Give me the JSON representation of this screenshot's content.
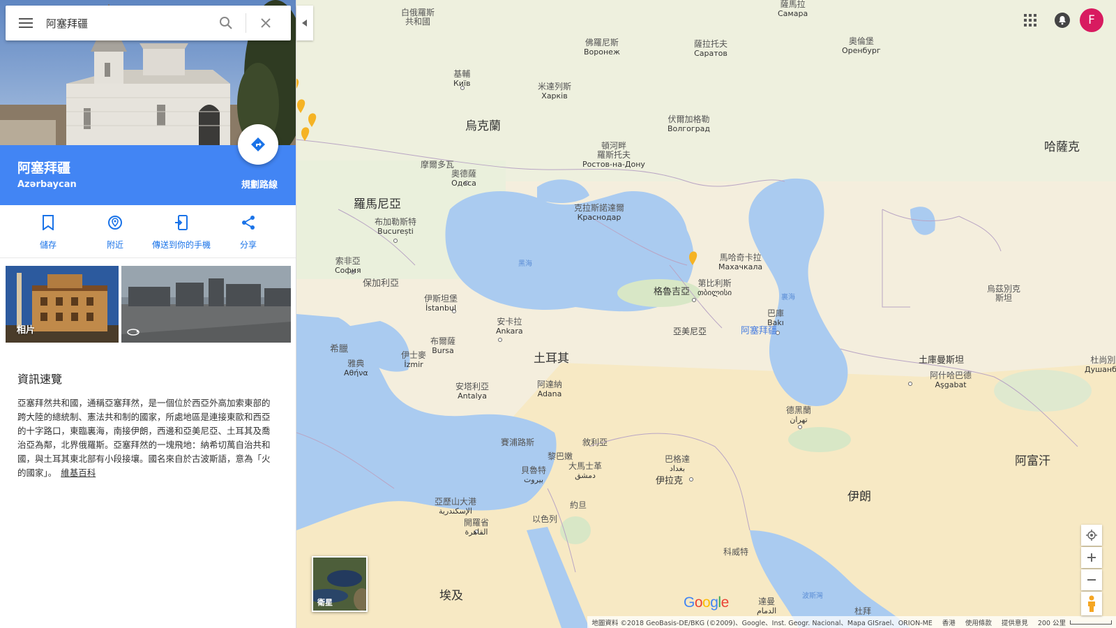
{
  "search": {
    "value": "阿塞拜疆"
  },
  "place": {
    "title": "阿塞拜疆",
    "subtitle": "Azərbaycan",
    "directions_label": "規劃路線"
  },
  "actions": [
    {
      "label": "儲存",
      "icon": "bookmark-icon"
    },
    {
      "label": "附近",
      "icon": "nearby-icon"
    },
    {
      "label": "傳送到你的手機",
      "icon": "send-to-phone-icon"
    },
    {
      "label": "分享",
      "icon": "share-icon"
    }
  ],
  "photos": {
    "label": "相片"
  },
  "overview": {
    "title": "資訊速覽",
    "text": "亞塞拜然共和國，通稱亞塞拜然，是一個位於西亞外高加索東部的跨大陸的總統制、憲法共和制的國家，所處地區是連接東歐和西亞的十字路口，東臨裏海，南接伊朗，西邊和亞美尼亞、土耳其及喬治亞為鄰，北界俄羅斯。亞塞拜然的一塊飛地：納希切萬自治共和國，與土耳其東北部有小段接壤。國名來自於古波斯語，意為「火的國家」。",
    "link": "維基百科"
  },
  "user": {
    "initial": "F"
  },
  "map": {
    "satellite_label": "衛星",
    "logo": "Google",
    "attribution": [
      "地圖資料 ©2018 GeoBasis-DE/BKG (©2009)、Google、Inst. Geogr. Nacional、Mapa GISrael、ORION-ME",
      "香港",
      "使用條款",
      "提供意見",
      "200 公里"
    ],
    "labels": {
      "belarus": "白俄羅斯\n共和國",
      "samara": "薩馬拉\nСамара",
      "voronezh": "佛羅尼斯\nВоронеж",
      "saratov": "薩拉托夫\nСаратов",
      "orenburg": "奧倫堡\nОренбург",
      "kyiv": "基輔\nКиїв",
      "kharkiv": "米達列斯\nХарків",
      "volgograd": "伏爾加格勒\nВолгоград",
      "ukraine": "烏克蘭",
      "kazakhstan": "哈薩克",
      "rostov": "頓河畔\n羅斯托夫\nРостов-на-Дону",
      "moldova": "摩爾多瓦",
      "odesa": "奧德薩\nОдеса",
      "romania": "羅馬尼亞",
      "bucharest": "布加勒斯特\nBucurești",
      "krasnodar": "克拉斯諾達爾\nКраснодар",
      "makhachkala": "馬哈奇卡拉\nМахачкала",
      "black_sea": "黑海",
      "caspian": "裏海",
      "georgia": "格魯吉亞",
      "tbilisi": "第比利斯\nთბილისი",
      "uzbekistan": "烏茲別克\n斯坦",
      "sofia": "索非亞\nСофия",
      "bulgaria": "保加利亞",
      "istanbul": "伊斯坦堡\nİstanbul",
      "baku": "巴庫\nBakı",
      "armenia": "亞美尼亞",
      "azerbaijan": "阿塞拜疆",
      "ankara": "安卡拉\nAnkara",
      "bursa": "布爾薩\nBursa",
      "izmir": "伊士麥\nİzmir",
      "greece": "希臘",
      "athens": "雅典\nΑθήνα",
      "turkey": "土耳其",
      "turkmenistan": "土庫曼斯坦",
      "ashgabat": "阿什哈巴德\nAşgabat",
      "dushanbe": "杜尚別\nДушанбе",
      "antalya": "安塔利亞\nAntalya",
      "adana": "阿達納\nAdana",
      "tehran": "德黑蘭\nتهران",
      "cyprus": "賽浦路斯",
      "syria": "敘利亞",
      "lebanon": "黎巴嫩",
      "beirut": "貝魯特\nبيروت",
      "damascus": "大馬士革\nدمشق",
      "baghdad": "巴格達\nبغداد",
      "iraq": "伊拉克",
      "afghanistan": "阿富汗",
      "jordan": "約旦",
      "israel": "以色列",
      "iran": "伊朗",
      "alexandria": "亞歷山大港\nالإسكندرية",
      "cairo": "開羅省\nالقاهرة",
      "kuwait": "科威特",
      "egypt": "埃及",
      "persian_gulf": "波斯灣",
      "doha": "達曼\nالدمام",
      "dubai": "杜拜"
    }
  }
}
